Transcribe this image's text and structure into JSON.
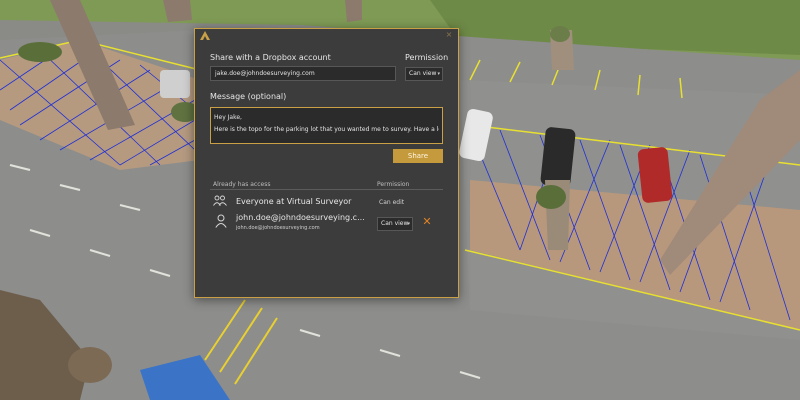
{
  "dialog": {
    "title": "Share with a Dropbox account",
    "permission_label": "Permission",
    "email_value": "jake.doe@johndoesurveying.com",
    "email_permission": "Can view",
    "message_label": "Message (optional)",
    "message_lines": [
      "Hey Jake,",
      "Here is the topo for the parking lot that you wanted me to survey. Have a look."
    ],
    "share_button": "Share",
    "access_header": "Already has access",
    "access_permission_header": "Permission",
    "access_rows": [
      {
        "name": "Everyone at Virtual Surveyor",
        "permission": "Can edit",
        "icon": "group-icon"
      },
      {
        "name": "john.doe@johndoesurveying.c...",
        "email": "john.doe@johndoesurveying.com",
        "permission": "Can view",
        "icon": "user-icon"
      }
    ],
    "close_symbol": "×",
    "remove_symbol": "✕"
  },
  "colors": {
    "accent": "#c9a046",
    "dialog_bg": "#3c3c3c",
    "remove": "#e08224",
    "mesh_lines": "#1f2fd6",
    "curb_lines": "#e8e030"
  }
}
